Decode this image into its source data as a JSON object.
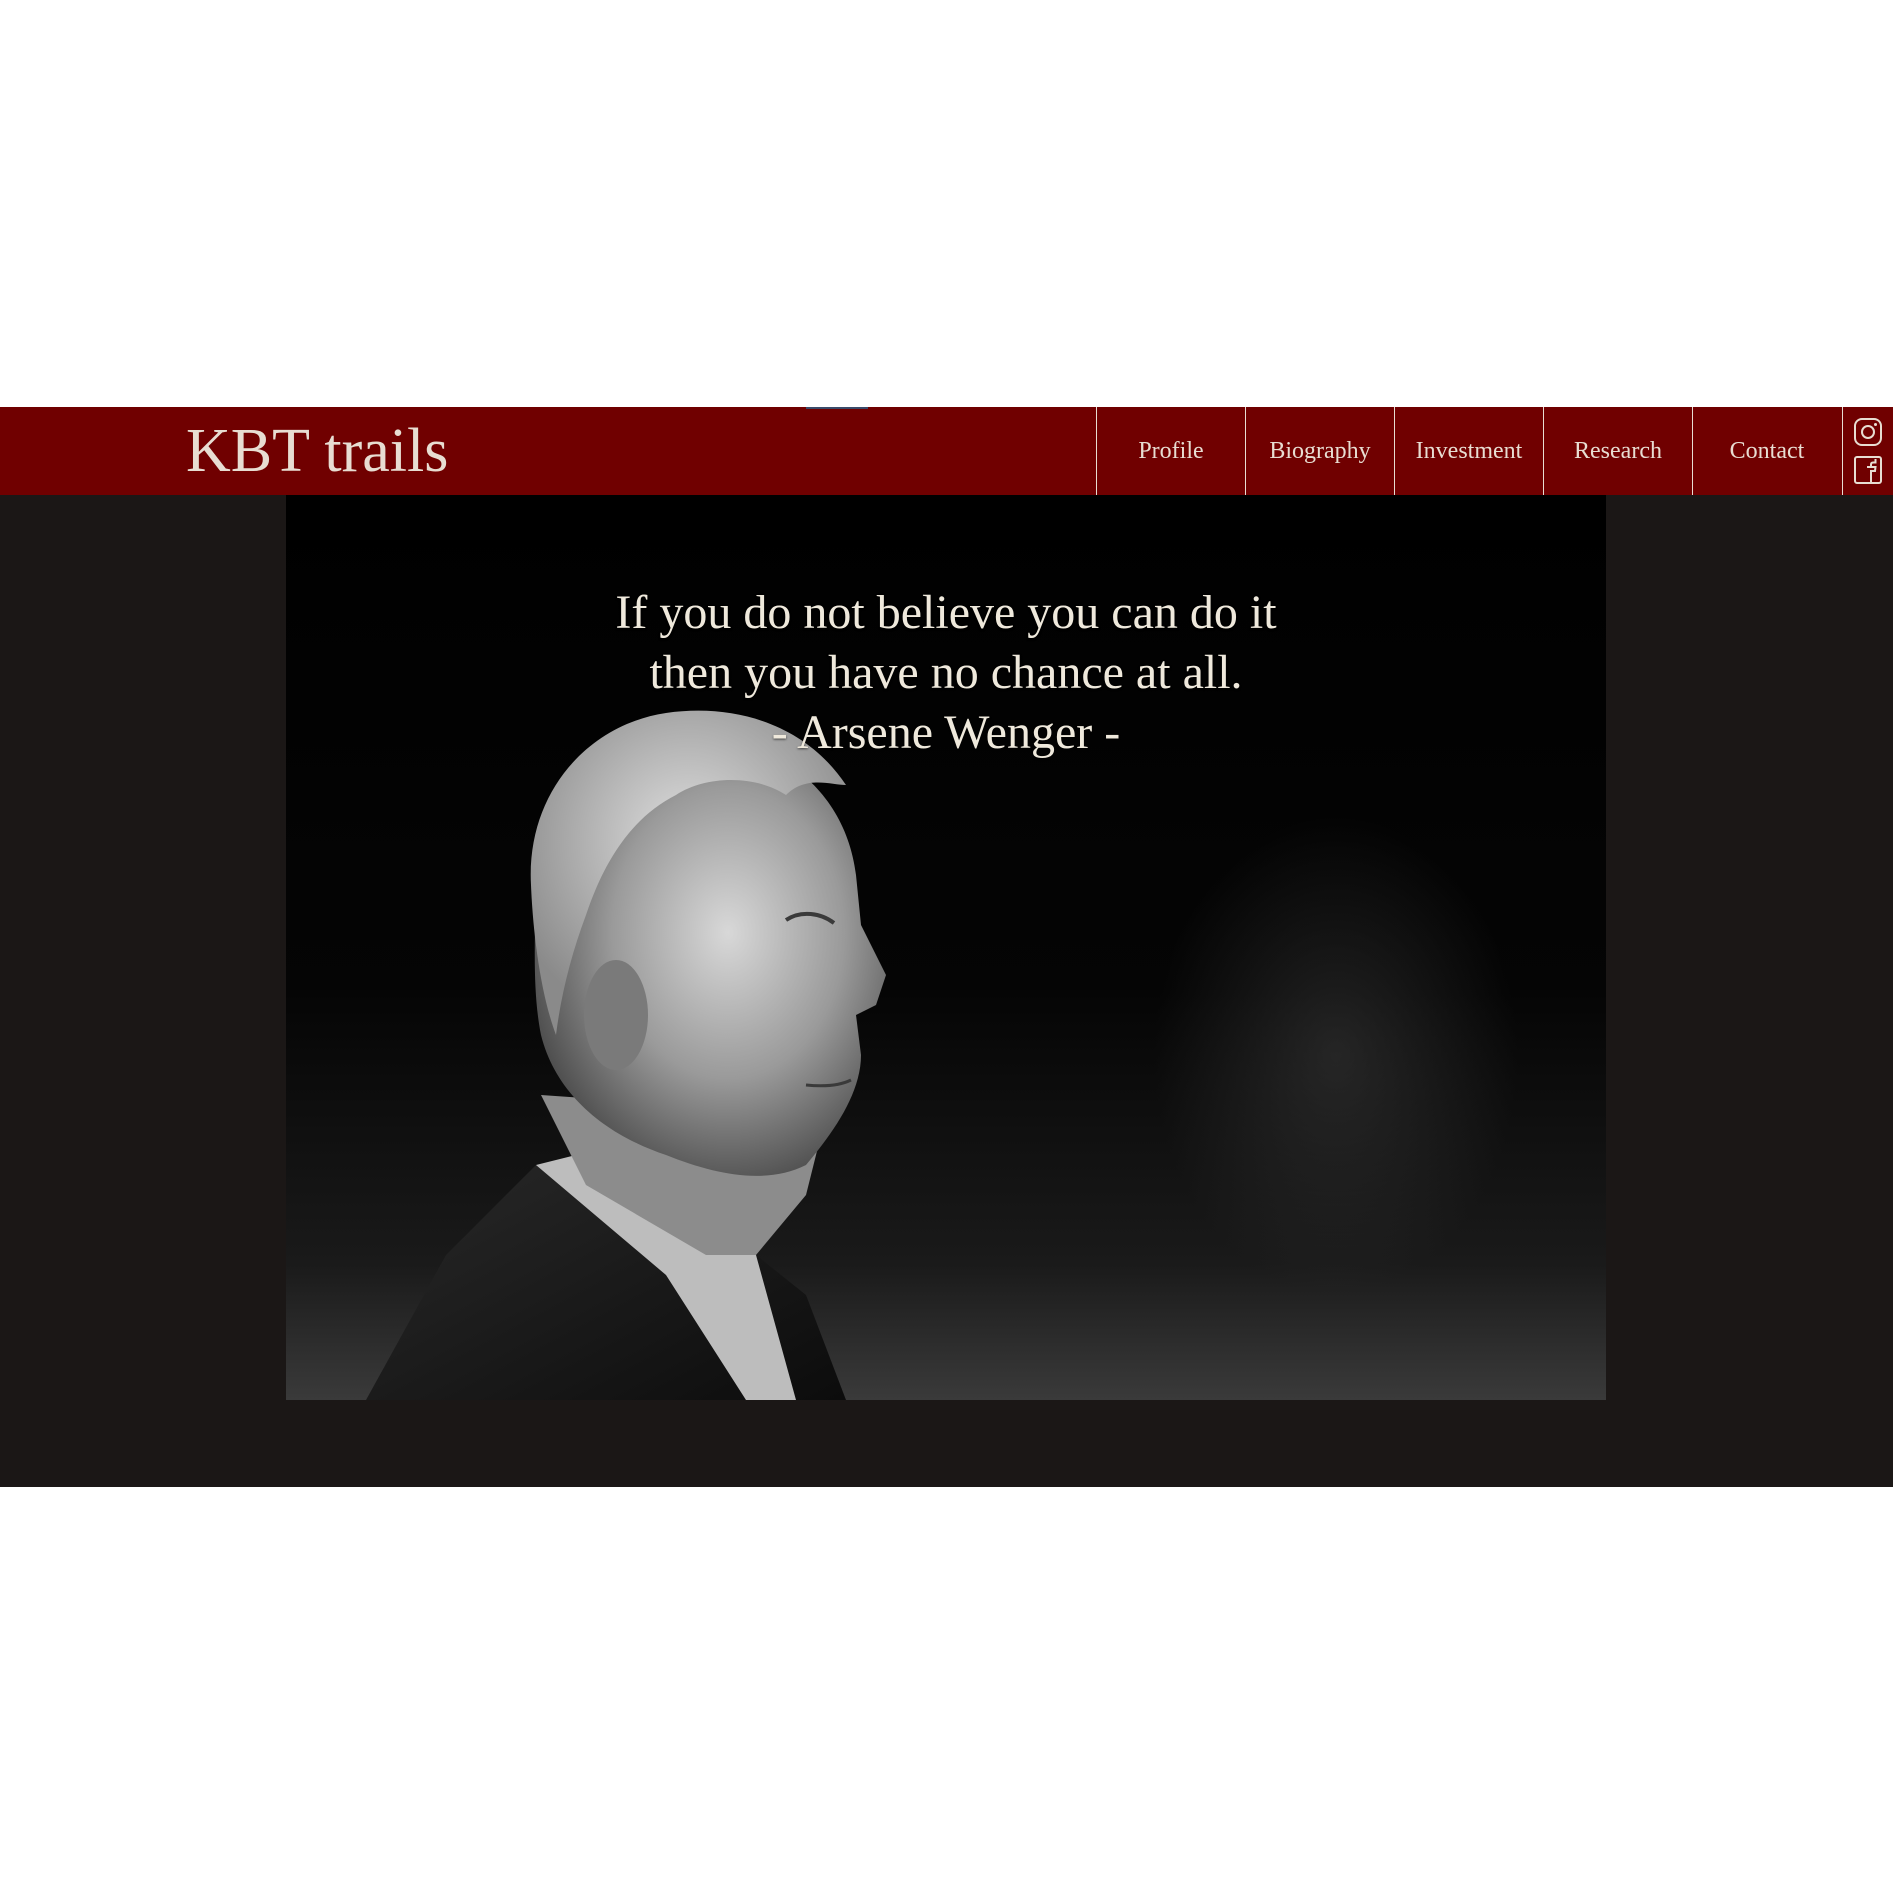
{
  "header": {
    "brand": "KBT trails",
    "nav": [
      {
        "label": "Profile"
      },
      {
        "label": "Biography"
      },
      {
        "label": "Investment"
      },
      {
        "label": "Research"
      },
      {
        "label": "Contact"
      }
    ],
    "social": [
      "instagram-icon",
      "facebook-icon"
    ],
    "colors": {
      "bar": "#700000",
      "text": "#e8ddd2"
    }
  },
  "hero": {
    "quote_line1": "If you do not believe you can do it",
    "quote_line2": "then you have no chance at all.",
    "attribution": "- Arsene Wenger -",
    "colors": {
      "background": "#1b1716",
      "quote": "#efe9dc"
    }
  }
}
